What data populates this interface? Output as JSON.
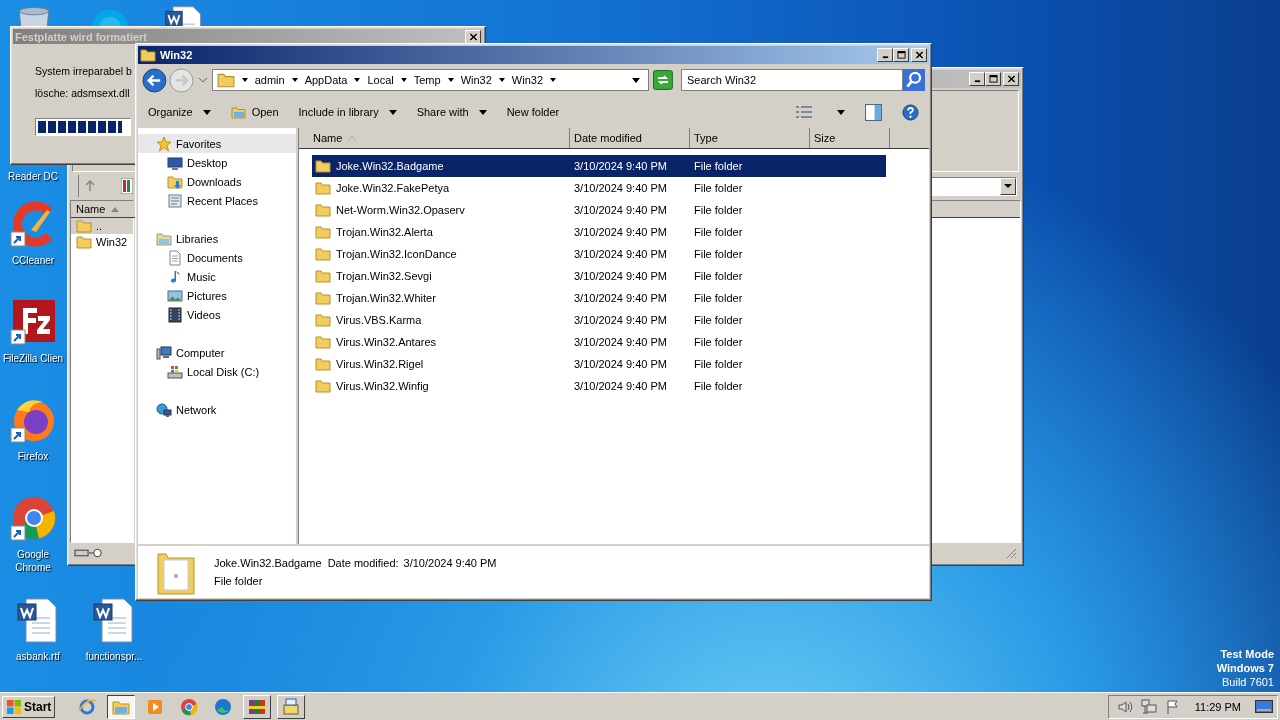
{
  "desktop": {
    "icons": [
      {
        "kind": "covered",
        "label": "Reader DC"
      },
      {
        "kind": "ccleaner",
        "label": "CCleaner"
      },
      {
        "kind": "filezilla",
        "label": "FileZilla Clien"
      },
      {
        "kind": "firefox",
        "label": "Firefox"
      },
      {
        "kind": "chrome",
        "label": "Google Chrome"
      }
    ],
    "bottom_icons": [
      {
        "kind": "word",
        "label": "asbank.rtf"
      },
      {
        "kind": "word",
        "label": "functionspr..."
      }
    ],
    "watermark": [
      "Test Mode",
      "Windows 7",
      "Build 7601"
    ]
  },
  "back_window": {
    "list_header": "Name",
    "rows": [
      {
        "name": "..",
        "selected": true
      },
      {
        "name": "Win32",
        "selected": false
      }
    ]
  },
  "dialog": {
    "title": "Festplatte wird formatiert",
    "lines": [
      "System irreparabel b",
      "lösche: adsmsext.dll"
    ],
    "progress": {
      "level": 0.93
    }
  },
  "explorer": {
    "title": "Win32",
    "breadcrumb": [
      "admin",
      "AppData",
      "Local",
      "Temp",
      "Win32",
      "Win32"
    ],
    "search": {
      "placeholder": "Search Win32"
    },
    "toolbar": [
      {
        "label": "Organize",
        "kind": "menu"
      },
      {
        "label": "Open",
        "kind": "open"
      },
      {
        "label": "Include in library",
        "kind": "menu"
      },
      {
        "label": "Share with",
        "kind": "menu"
      },
      {
        "label": "New folder",
        "kind": "plain"
      }
    ],
    "nav": [
      {
        "label": "Favorites",
        "kind": "star",
        "selected": true,
        "children": [
          {
            "label": "Desktop",
            "kind": "desktop",
            "selected": false
          },
          {
            "label": "Downloads",
            "kind": "downloads",
            "selected": false
          },
          {
            "label": "Recent Places",
            "kind": "recent",
            "selected": false
          }
        ]
      },
      {
        "label": "Libraries",
        "kind": "libraries",
        "selected": false,
        "children": [
          {
            "label": "Documents",
            "kind": "documents",
            "selected": false
          },
          {
            "label": "Music",
            "kind": "music",
            "selected": false
          },
          {
            "label": "Pictures",
            "kind": "pictures",
            "selected": false
          },
          {
            "label": "Videos",
            "kind": "videos",
            "selected": false
          }
        ]
      },
      {
        "label": "Computer",
        "kind": "computer",
        "selected": false,
        "children": [
          {
            "label": "Local Disk (C:)",
            "kind": "disk",
            "selected": false
          }
        ]
      },
      {
        "label": "Network",
        "kind": "network",
        "selected": false
      }
    ],
    "columns": [
      {
        "label": "Name",
        "sorted": true
      },
      {
        "label": "Date modified",
        "sorted": false
      },
      {
        "label": "Type",
        "sorted": false
      },
      {
        "label": "Size",
        "sorted": false
      }
    ],
    "rows": [
      {
        "name": "Joke.Win32.Badgame",
        "date": "3/10/2024 9:40 PM",
        "type": "File folder",
        "selected": true
      },
      {
        "name": "Joke.Win32.FakePetya",
        "date": "3/10/2024 9:40 PM",
        "type": "File folder",
        "selected": false
      },
      {
        "name": "Net-Worm.Win32.Opaserv",
        "date": "3/10/2024 9:40 PM",
        "type": "File folder",
        "selected": false
      },
      {
        "name": "Trojan.Win32.Alerta",
        "date": "3/10/2024 9:40 PM",
        "type": "File folder",
        "selected": false
      },
      {
        "name": "Trojan.Win32.IconDance",
        "date": "3/10/2024 9:40 PM",
        "type": "File folder",
        "selected": false
      },
      {
        "name": "Trojan.Win32.Sevgi",
        "date": "3/10/2024 9:40 PM",
        "type": "File folder",
        "selected": false
      },
      {
        "name": "Trojan.Win32.Whiter",
        "date": "3/10/2024 9:40 PM",
        "type": "File folder",
        "selected": false
      },
      {
        "name": "Virus.VBS.Karma",
        "date": "3/10/2024 9:40 PM",
        "type": "File folder",
        "selected": false
      },
      {
        "name": "Virus.Win32.Antares",
        "date": "3/10/2024 9:40 PM",
        "type": "File folder",
        "selected": false
      },
      {
        "name": "Virus.Win32.Rigel",
        "date": "3/10/2024 9:40 PM",
        "type": "File folder",
        "selected": false
      },
      {
        "name": "Virus.Win32.Winfig",
        "date": "3/10/2024 9:40 PM",
        "type": "File folder",
        "selected": false
      }
    ],
    "details": {
      "name": "Joke.Win32.Badgame",
      "date_label": "Date modified:",
      "date": "3/10/2024 9:40 PM",
      "type": "File folder"
    }
  },
  "taskbar": {
    "start": "Start",
    "apps": [
      {
        "kind": "ie",
        "active": false,
        "open": false
      },
      {
        "kind": "explorer",
        "active": true
      },
      {
        "kind": "media",
        "active": false,
        "open": false
      },
      {
        "kind": "chrome",
        "active": false,
        "open": false
      },
      {
        "kind": "edge",
        "active": false,
        "open": false
      },
      {
        "kind": "winrar",
        "active": false,
        "open": true
      },
      {
        "kind": "installer",
        "active": false,
        "open": true
      }
    ],
    "clock": "11:29 PM"
  }
}
